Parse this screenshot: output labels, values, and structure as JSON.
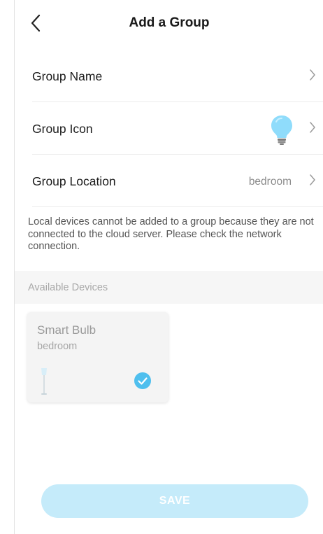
{
  "header": {
    "title": "Add a Group",
    "back_icon": "chevron-left-icon"
  },
  "form": {
    "group_name_label": "Group Name",
    "group_icon_label": "Group Icon",
    "group_icon": "light-bulb-icon",
    "group_location_label": "Group Location",
    "group_location_value": "bedroom"
  },
  "notice": "Local devices cannot be added to a group because they are not connected to the cloud server. Please check the network connection.",
  "available_devices": {
    "header": "Available Devices",
    "devices": [
      {
        "name": "Smart Bulb",
        "location": "bedroom",
        "icon": "floor-lamp-icon",
        "selected": true
      }
    ]
  },
  "save_label": "SAVE",
  "colors": {
    "accent": "#4fbfee",
    "save_disabled": "#c5ebfa",
    "bulb": "#8fdcfb"
  }
}
